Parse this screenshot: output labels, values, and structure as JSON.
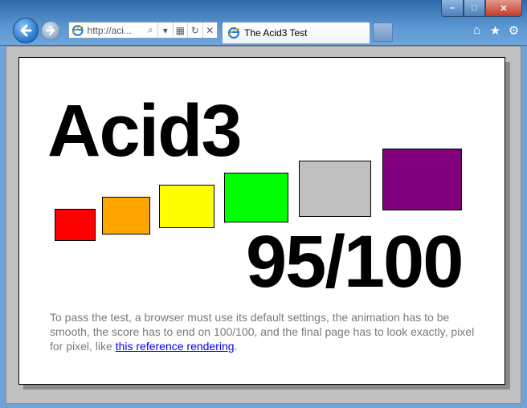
{
  "window": {
    "caption_min": "–",
    "caption_max": "□",
    "caption_close": "✕"
  },
  "toolbar": {
    "address_text": "http://aci...",
    "search_glyph": "⌕",
    "dropdown_glyph": "▾",
    "compat_glyph": "▦",
    "refresh_glyph": "↻",
    "stop_glyph": "✕",
    "tab_title": "The Acid3 Test",
    "home_glyph": "⌂",
    "favorites_glyph": "★",
    "tools_glyph": "⚙"
  },
  "page": {
    "heading": "Acid3",
    "score": "95/100",
    "description_before": "To pass the test, a browser must use its default settings, the animation has to be smooth, the score has to end on 100/100, and the final page has to look exactly, pixel for pixel, like ",
    "link_text": "this reference rendering",
    "description_after": ".",
    "boxes": [
      {
        "name": "red-box",
        "color": "#ff0000"
      },
      {
        "name": "orange-box",
        "color": "#ffa500"
      },
      {
        "name": "yellow-box",
        "color": "#ffff00"
      },
      {
        "name": "lime-box",
        "color": "#00ff00"
      },
      {
        "name": "silver-box",
        "color": "#c0c0c0"
      },
      {
        "name": "purple-box",
        "color": "#800080"
      }
    ]
  }
}
